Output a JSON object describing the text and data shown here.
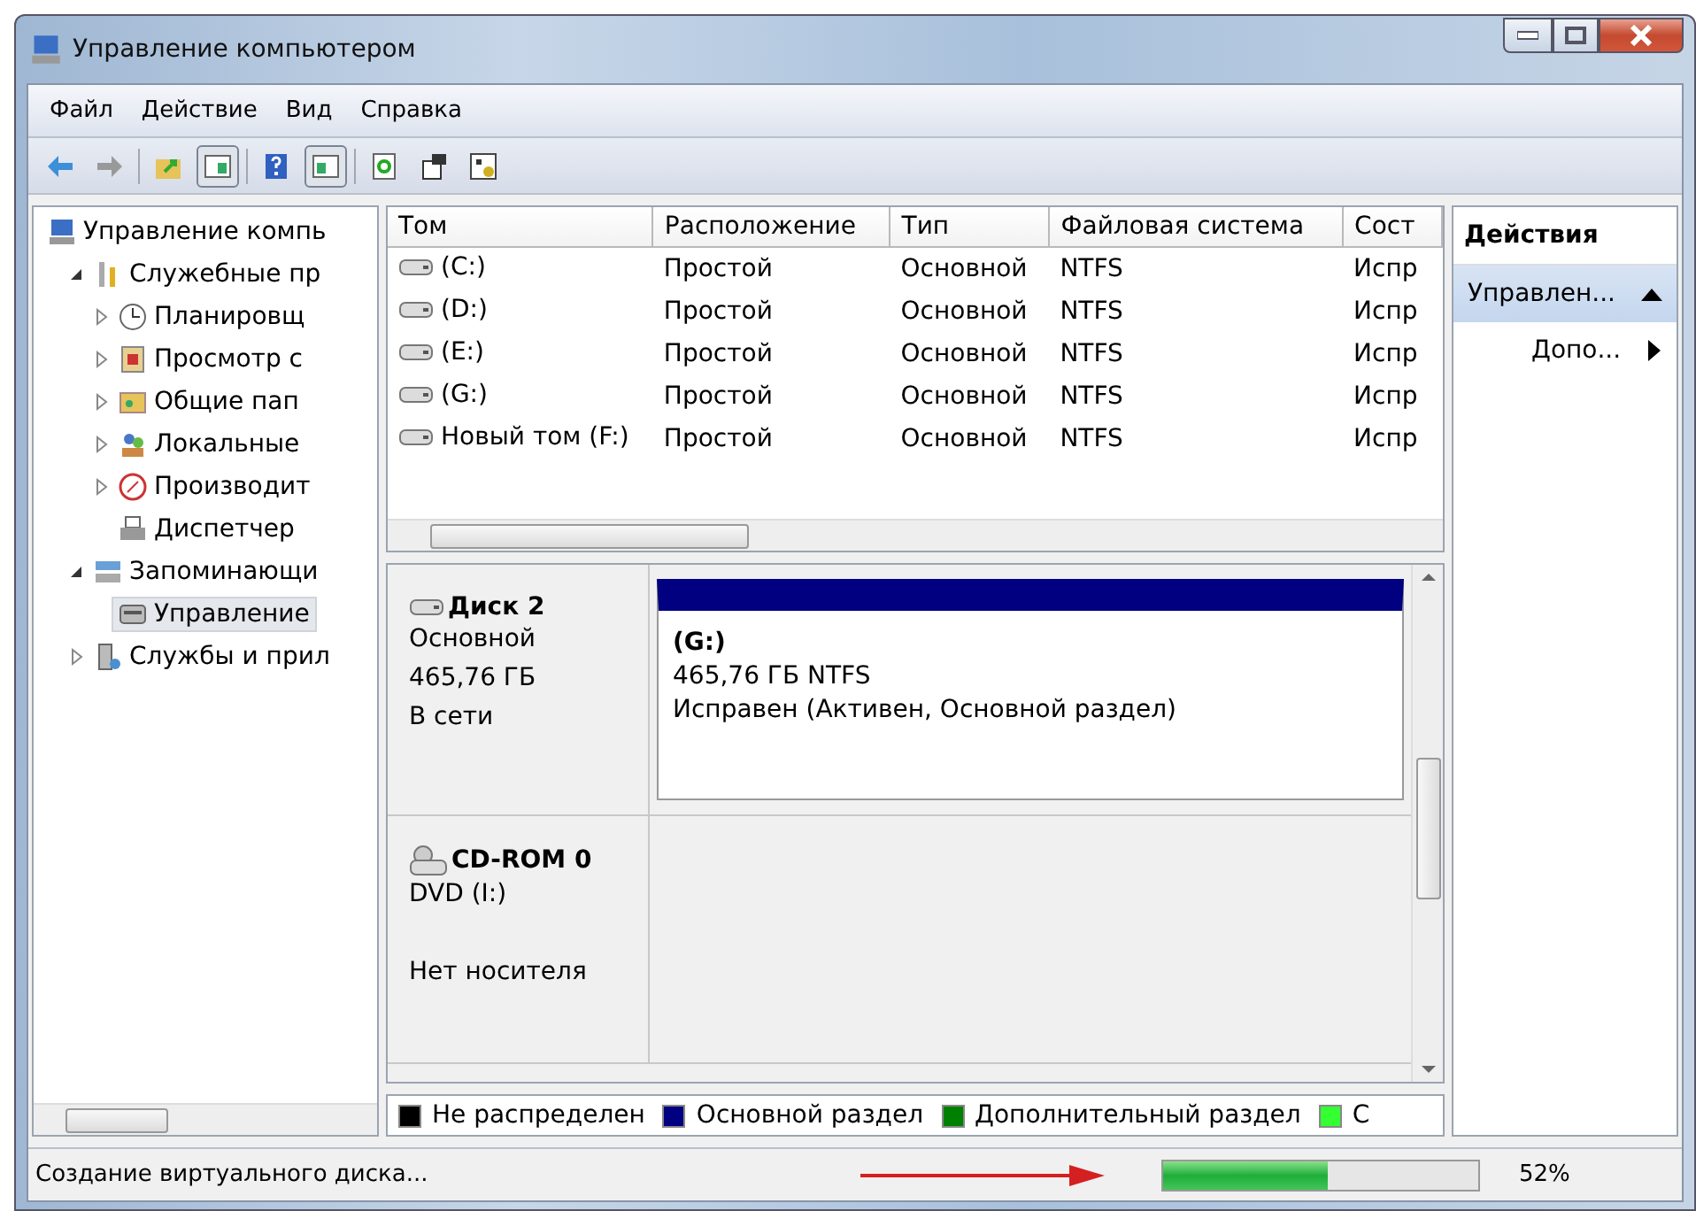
{
  "window": {
    "title": "Управление компьютером"
  },
  "menu": [
    "Файл",
    "Действие",
    "Вид",
    "Справка"
  ],
  "toolbar": [
    [
      {
        "kind": "back",
        "pressed": false
      },
      {
        "kind": "forward",
        "pressed": false
      }
    ],
    [
      {
        "kind": "up",
        "pressed": false
      },
      {
        "kind": "tree",
        "pressed": true
      }
    ],
    [
      {
        "kind": "help",
        "pressed": false
      },
      {
        "kind": "actions",
        "pressed": true
      }
    ],
    [
      {
        "kind": "refresh",
        "pressed": false
      },
      {
        "kind": "properties",
        "pressed": false
      },
      {
        "kind": "export",
        "pressed": false
      }
    ]
  ],
  "tree": [
    {
      "label": "Управление компь",
      "kind": "computer",
      "selected": false,
      "children": [
        {
          "label": "Служебные пр",
          "kind": "tools",
          "selected": false,
          "expanded": true,
          "children": [
            {
              "label": "Планировщ",
              "kind": "clock",
              "selected": false,
              "expanded": false
            },
            {
              "label": "Просмотр с",
              "kind": "log",
              "selected": false,
              "expanded": false
            },
            {
              "label": "Общие пап",
              "kind": "share",
              "selected": false,
              "expanded": false
            },
            {
              "label": "Локальные",
              "kind": "users",
              "selected": false,
              "expanded": false
            },
            {
              "label": "Производит",
              "kind": "perf",
              "selected": false,
              "expanded": false
            },
            {
              "label": "Диспетчер",
              "kind": "devices",
              "selected": false
            }
          ]
        },
        {
          "label": "Запоминающи",
          "kind": "storage",
          "selected": false,
          "expanded": true,
          "children": [
            {
              "label": "Управление",
              "kind": "disk",
              "selected": true
            }
          ]
        },
        {
          "label": "Службы и прил",
          "kind": "services",
          "selected": false,
          "expanded": false
        }
      ]
    }
  ],
  "table": {
    "columns": [
      "Том",
      "Расположение",
      "Тип",
      "Файловая система",
      "Сост"
    ],
    "rows": [
      [
        "(C:)",
        "Простой",
        "Основной",
        "NTFS",
        "Испр"
      ],
      [
        "(D:)",
        "Простой",
        "Основной",
        "NTFS",
        "Испр"
      ],
      [
        "(E:)",
        "Простой",
        "Основной",
        "NTFS",
        "Испр"
      ],
      [
        "(G:)",
        "Простой",
        "Основной",
        "NTFS",
        "Испр"
      ],
      [
        "Новый том (F:)",
        "Простой",
        "Основной",
        "NTFS",
        "Испр"
      ]
    ]
  },
  "disks": [
    {
      "kind": "disk",
      "name": "Диск 2",
      "lines": [
        "Основной",
        "465,76 ГБ",
        "В сети"
      ],
      "partition": {
        "name": "(G:)",
        "color": "#000080",
        "lines": [
          "465,76 ГБ NTFS",
          "Исправен (Активен, Основной раздел)"
        ]
      }
    },
    {
      "kind": "cdrom",
      "name": "CD-ROM 0",
      "lines": [
        "DVD (I:)",
        "Нет носителя"
      ]
    }
  ],
  "legend": [
    {
      "label": "Не распределен",
      "color": "#000000"
    },
    {
      "label": "Основной раздел",
      "color": "#000080"
    },
    {
      "label": "Дополнительный раздел",
      "color": "#008000"
    },
    {
      "label": "С",
      "color": "#33ff33"
    }
  ],
  "actions": {
    "title": "Действия",
    "items": [
      {
        "label": "Управлен...",
        "kind": "section",
        "selected": true
      },
      {
        "label": "Допо...",
        "kind": "submenu",
        "selected": false
      }
    ]
  },
  "status_bar": {
    "text": "Создание виртуального диска...",
    "level": 0.52,
    "reading": "52%"
  }
}
